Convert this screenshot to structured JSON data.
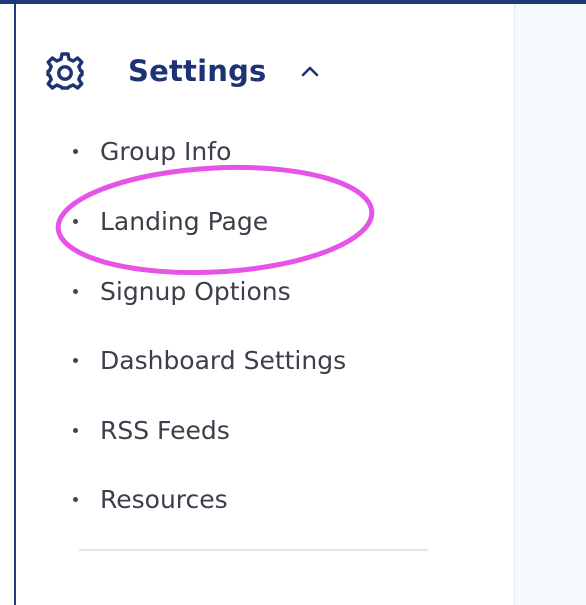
{
  "sidebar": {
    "section": {
      "title": "Settings",
      "icon": "gear-icon",
      "expanded": true,
      "chevron": "chevron-up-icon"
    },
    "items": [
      {
        "label": "Group Info"
      },
      {
        "label": "Landing Page"
      },
      {
        "label": "Signup Options"
      },
      {
        "label": "Dashboard Settings"
      },
      {
        "label": "RSS Feeds"
      },
      {
        "label": "Resources"
      }
    ]
  },
  "annotation": {
    "shape": "ellipse",
    "color": "#e653e6",
    "target": "Landing Page"
  },
  "colors": {
    "accent": "#1d3374",
    "frame_border": "#1e3a78",
    "text": "#3a3f4a",
    "main_bg": "#f6f9fc"
  }
}
